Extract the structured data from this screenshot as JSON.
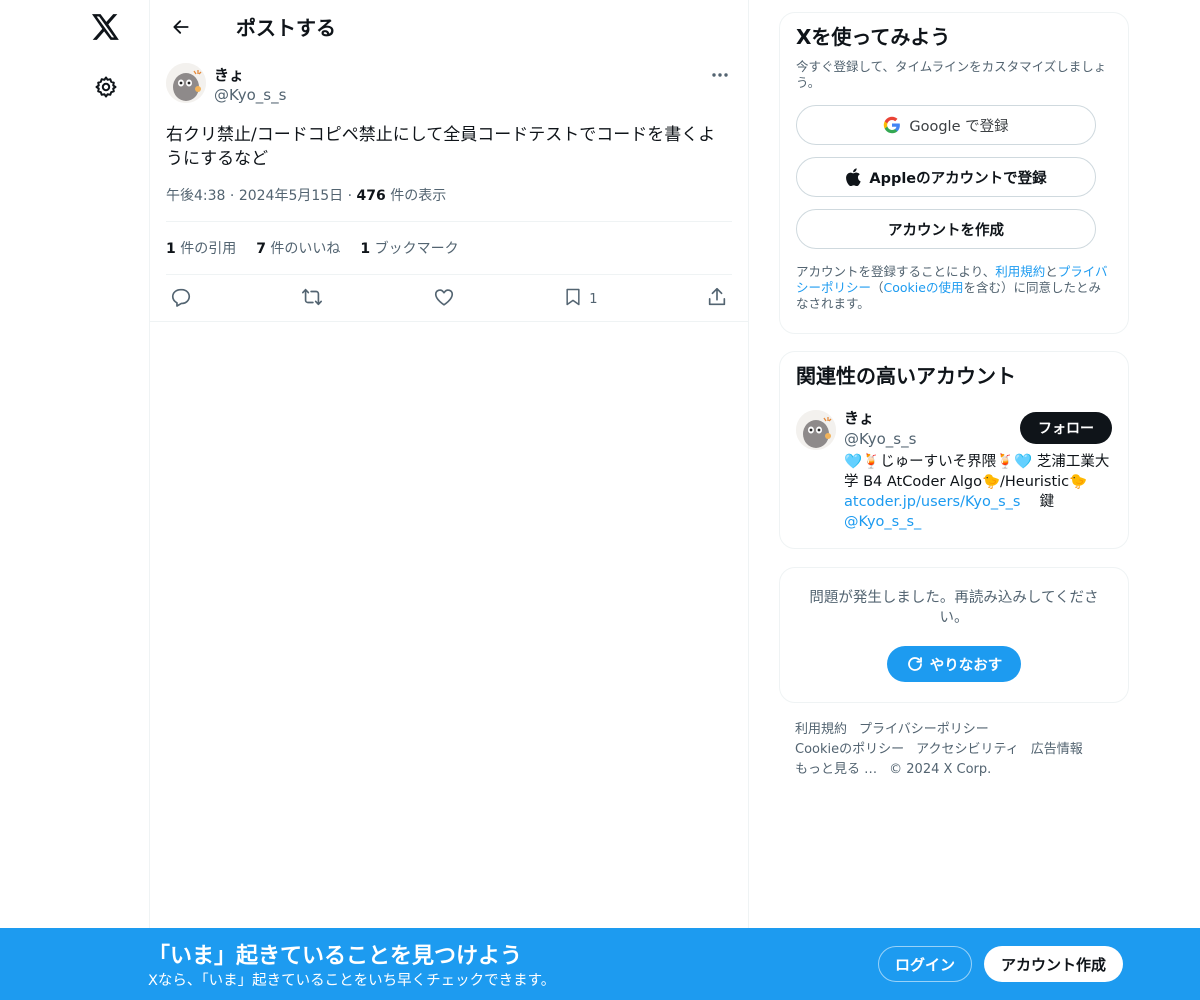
{
  "nav": {
    "logo_icon": "x-logo-icon",
    "settings_icon": "gear-icon"
  },
  "header": {
    "title": "ポストする",
    "back_icon": "arrow-left-icon"
  },
  "tweet": {
    "author_name": "きょ",
    "author_handle": "@Kyo_s_s",
    "text": "右クリ禁止/コードコピペ禁止にして全員コードテストでコードを書くようにするなど",
    "time": "午後4:38",
    "date": "2024年5月15日",
    "views": "476",
    "views_label": "件の表示",
    "quotes": "1",
    "quotes_label": "件の引用",
    "likes": "7",
    "likes_label": "件のいいね",
    "bookmarks": "1",
    "bookmarks_label": "ブックマーク",
    "bookmark_count": "1"
  },
  "signup": {
    "title": "Xを使ってみよう",
    "subtitle": "今すぐ登録して、タイムラインをカスタマイズしましょう。",
    "google_label": "Google で登録",
    "apple_label": "Appleのアカウントで登録",
    "create_label": "アカウントを作成",
    "legal_pre": "アカウントを登録することにより、",
    "legal_terms": "利用規約",
    "legal_and": "と",
    "legal_privacy": "プライバシーポリシー",
    "legal_paren_open": "（",
    "legal_cookie": "Cookieの使用",
    "legal_post": "を含む）に同意したとみなされます。"
  },
  "related": {
    "title": "関連性の高いアカウント",
    "name": "きょ",
    "handle": "@Kyo_s_s",
    "bio": "🩵🍹じゅーすいそ界隈🍹🩵 芝浦工業大学 B4 AtCoder Algo🐤/Heuristic🐤",
    "bio_link": "atcoder.jp/users/Kyo_s_s",
    "bio_lock": "鍵",
    "bio_mention": "@Kyo_s_s_",
    "follow_label": "フォロー"
  },
  "error": {
    "message": "問題が発生しました。再読み込みしてください。",
    "retry_label": "やりなおす"
  },
  "footer": {
    "terms": "利用規約",
    "privacy": "プライバシーポリシー",
    "cookie": "Cookieのポリシー",
    "accessibility": "アクセシビリティ",
    "ads": "広告情報",
    "more": "もっと見る …",
    "copyright": "© 2024 X Corp."
  },
  "banner": {
    "title": "「いま」起きていることを見つけよう",
    "subtitle": "Xなら、「いま」起きていることをいち早くチェックできます。",
    "login_label": "ログイン",
    "signup_label": "アカウント作成"
  },
  "colors": {
    "accent": "#1d9bf0",
    "text": "#0f1419",
    "muted": "#536471",
    "border": "#eff3f4"
  }
}
